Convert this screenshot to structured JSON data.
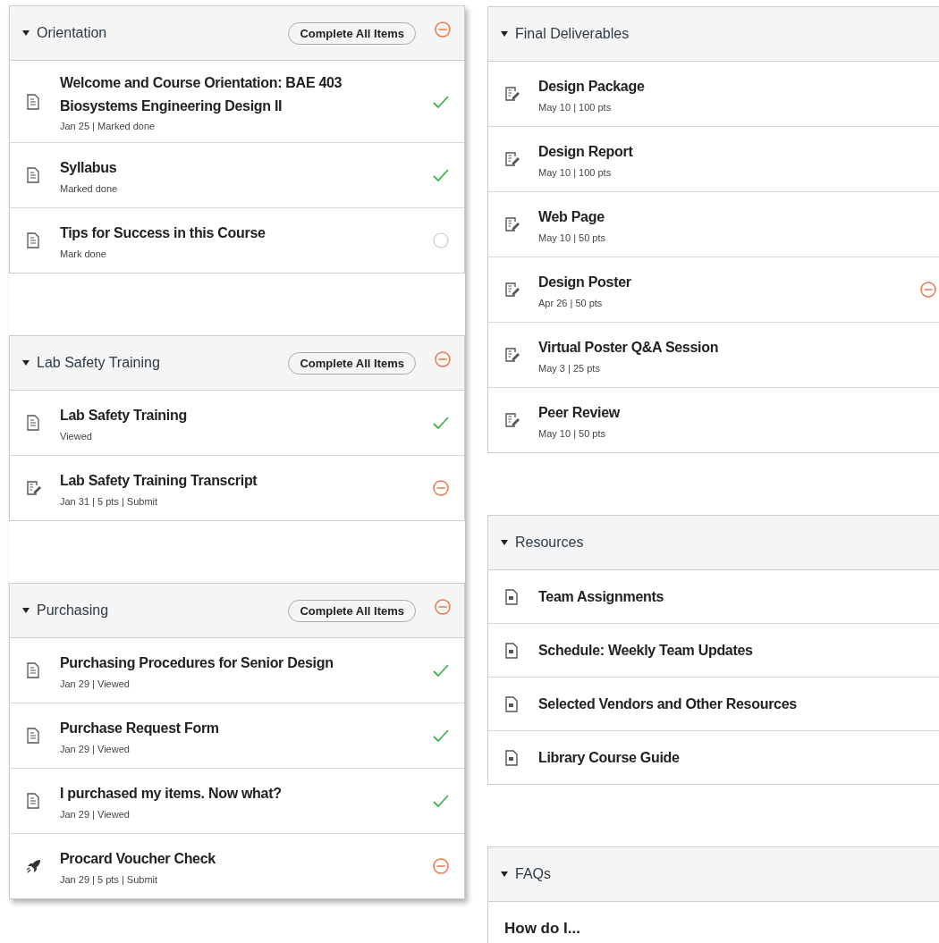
{
  "columns": [
    {
      "modules": [
        {
          "title": "Orientation",
          "complete_all": "Complete All Items",
          "missing": true,
          "items": [
            {
              "kind": "page",
              "title": "Welcome and Course Orientation: BAE 403 Biosystems Engineering Design II",
              "meta": "Jan 25 | Marked done",
              "done": true
            },
            {
              "kind": "page",
              "title": "Syllabus",
              "meta": "Marked done",
              "done": true
            },
            {
              "kind": "page",
              "title": "Tips for Success in this Course",
              "meta": "Mark done",
              "done": false
            }
          ]
        },
        {
          "title": "Lab Safety Training",
          "complete_all": "Complete All Items",
          "missing": true,
          "items": [
            {
              "kind": "page",
              "title": "Lab Safety Training",
              "meta": "Viewed",
              "done": true
            },
            {
              "kind": "assignment",
              "title": "Lab Safety Training Transcript",
              "meta": "Jan 31 | 5 pts | Submit",
              "missing": true
            }
          ]
        },
        {
          "title": "Purchasing",
          "complete_all": "Complete All Items",
          "missing": true,
          "items": [
            {
              "kind": "page",
              "title": "Purchasing Procedures for Senior Design",
              "meta": "Jan 29 | Viewed",
              "done": true
            },
            {
              "kind": "page",
              "title": "Purchase Request Form",
              "meta": "Jan 29 | Viewed",
              "done": true
            },
            {
              "kind": "page",
              "title": "I purchased my items. Now what?",
              "meta": "Jan 29 | Viewed",
              "done": true
            },
            {
              "kind": "quiz",
              "title": "Procard Voucher Check",
              "meta": "Jan 29 | 5 pts | Submit",
              "missing": true
            }
          ]
        }
      ]
    },
    {
      "modules": [
        {
          "title": "Final Deliverables",
          "items": [
            {
              "kind": "assignment",
              "title": "Design Package",
              "meta": "May 10 | 100 pts"
            },
            {
              "kind": "assignment",
              "title": "Design Report",
              "meta": "May 10 | 100 pts"
            },
            {
              "kind": "assignment",
              "title": "Web Page",
              "meta": "May 10 | 50 pts"
            },
            {
              "kind": "assignment",
              "title": "Design Poster",
              "meta": "Apr 26 | 50 pts",
              "missing": true
            },
            {
              "kind": "assignment",
              "title": "Virtual Poster Q&A Session",
              "meta": "May 3 | 25 pts"
            },
            {
              "kind": "assignment",
              "title": "Peer Review",
              "meta": "May 10 | 50 pts"
            }
          ]
        },
        {
          "title": "Resources",
          "items": [
            {
              "kind": "file",
              "title": "Team Assignments"
            },
            {
              "kind": "file",
              "title": "Schedule: Weekly Team Updates"
            },
            {
              "kind": "file",
              "title": "Selected Vendors and Other Resources"
            },
            {
              "kind": "file",
              "title": "Library Course Guide"
            }
          ]
        },
        {
          "title": "FAQs",
          "items": [
            {
              "kind": "subheader",
              "title": "How do I..."
            }
          ]
        }
      ]
    }
  ]
}
